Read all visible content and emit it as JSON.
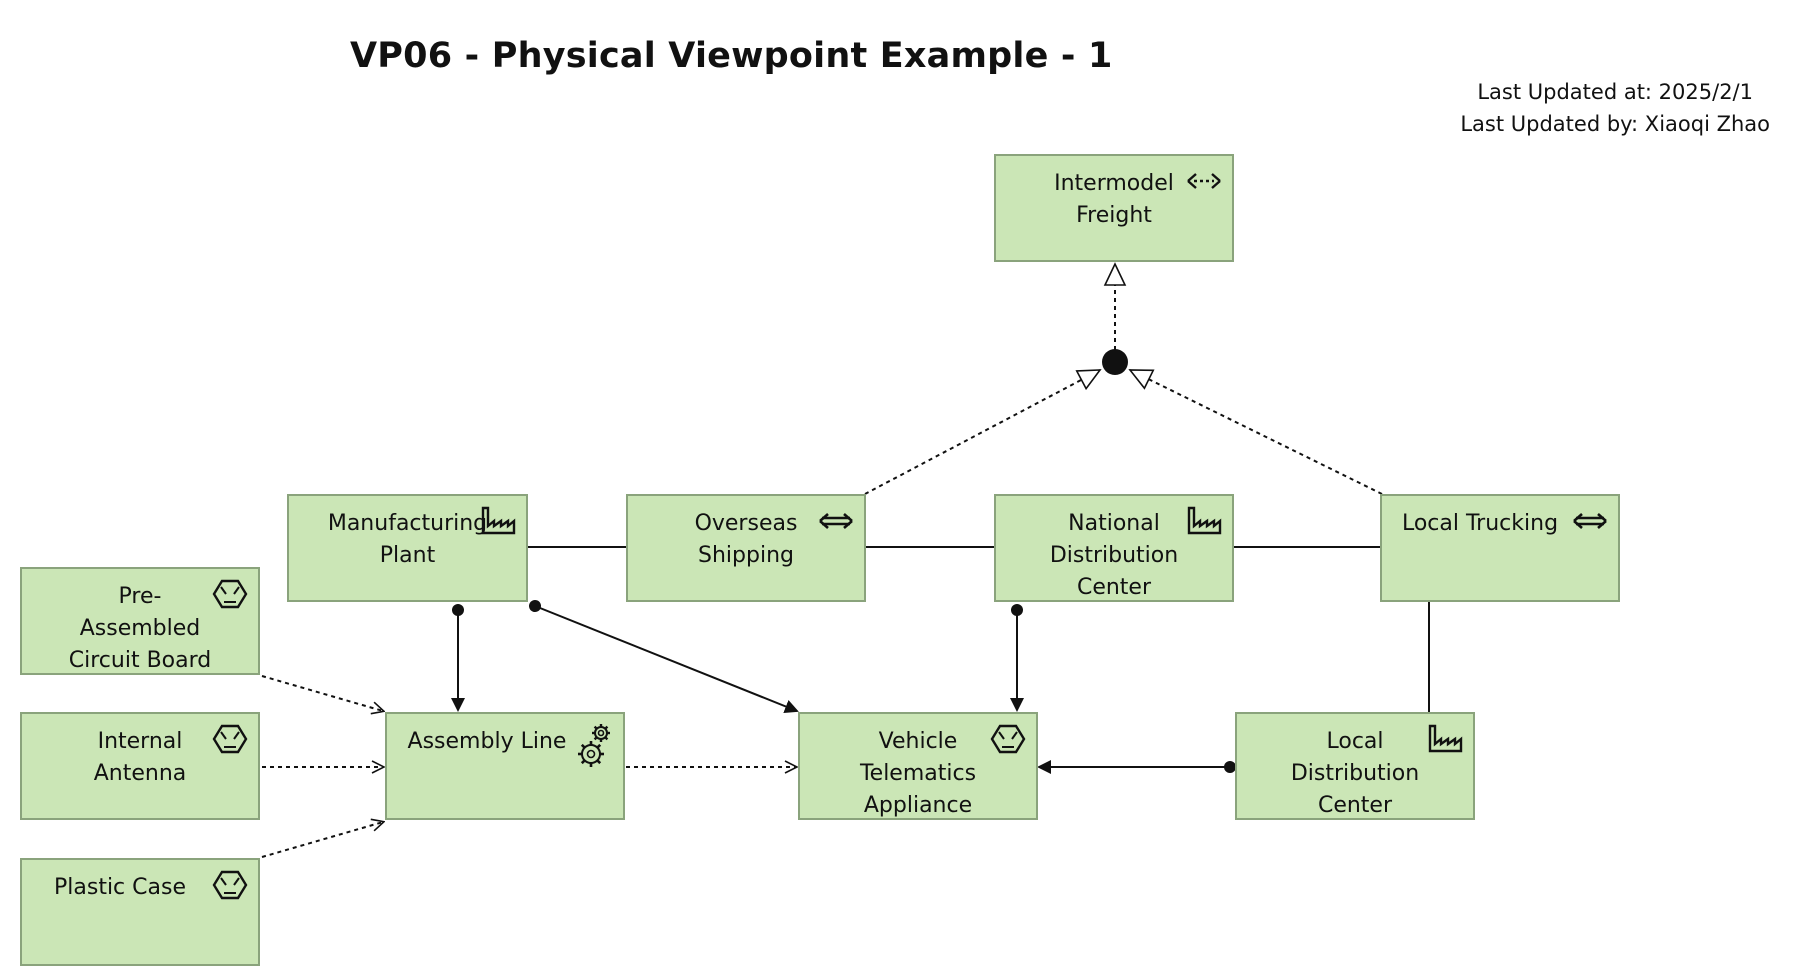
{
  "title": "VP06 - Physical Viewpoint Example - 1",
  "meta": {
    "updated_at": "Last Updated at: 2025/2/1",
    "updated_by": "Last Updated by: Xiaoqi Zhao"
  },
  "nodes": {
    "intermodel_freight": {
      "label": "Intermodel\nFreight",
      "icon": "distribution-network-icon"
    },
    "manufacturing_plant": {
      "label": "Manufacturing\nPlant",
      "icon": "facility-icon"
    },
    "overseas_shipping": {
      "label": "Overseas\nShipping",
      "icon": "distribution-network-icon"
    },
    "national_distribution_center": {
      "label": "National\nDistribution\nCenter",
      "icon": "facility-icon"
    },
    "local_trucking": {
      "label": "Local Trucking",
      "icon": "distribution-network-icon"
    },
    "pre_assembled_circuit_board": {
      "label": "Pre-\nAssembled\nCircuit Board",
      "icon": "material-icon"
    },
    "internal_antenna": {
      "label": "Internal\nAntenna",
      "icon": "material-icon"
    },
    "plastic_case": {
      "label": "Plastic Case",
      "icon": "material-icon"
    },
    "assembly_line": {
      "label": "Assembly Line",
      "icon": "equipment-icon"
    },
    "vehicle_telematics_appliance": {
      "label": "Vehicle\nTelematics\nAppliance",
      "icon": "material-icon"
    },
    "local_distribution_center": {
      "label": "Local\nDistribution\nCenter",
      "icon": "facility-icon"
    }
  },
  "colors": {
    "node_fill": "#cbe6b6",
    "node_border": "#8aa37c",
    "line": "#111111"
  }
}
